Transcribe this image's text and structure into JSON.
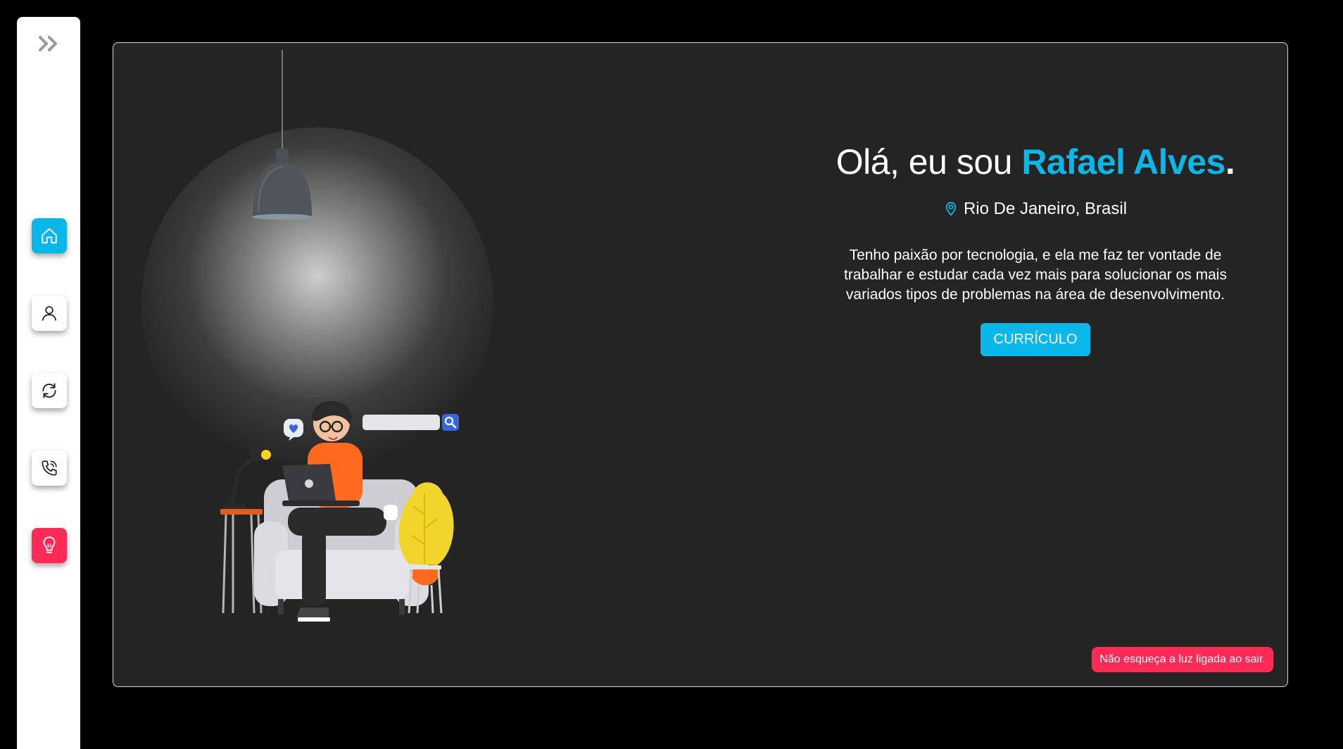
{
  "sidebar": {
    "expand_icon": "double-chevron-right-icon",
    "items": [
      {
        "name": "home",
        "icon": "home-icon",
        "active": true,
        "color": "#0ab7e8"
      },
      {
        "name": "about",
        "icon": "user-icon",
        "active": false
      },
      {
        "name": "refresh",
        "icon": "refresh-icon",
        "active": false
      },
      {
        "name": "contact",
        "icon": "phone-icon",
        "active": false
      },
      {
        "name": "light",
        "icon": "lightbulb-icon",
        "active": false,
        "color": "#ff2a55"
      }
    ]
  },
  "hero": {
    "greeting_prefix": "Olá, eu sou ",
    "name": "Rafael Alves",
    "name_suffix": ".",
    "location": "Rio De Janeiro, Brasil",
    "location_icon": "map-pin-icon",
    "bio": "Tenho paixão por tecnologia, e ela me faz ter vontade de trabalhar e estudar cada vez mais para solucionar os mais variados tipos de problemas na área de desenvolvimento.",
    "cv_button": "CURRÍCULO"
  },
  "toast": {
    "message": "Não esqueça a luz ligada ao sair."
  },
  "colors": {
    "accent": "#0ab7e8",
    "alert": "#ff2a55",
    "stage_bg": "#242424",
    "page_bg": "#000000"
  }
}
